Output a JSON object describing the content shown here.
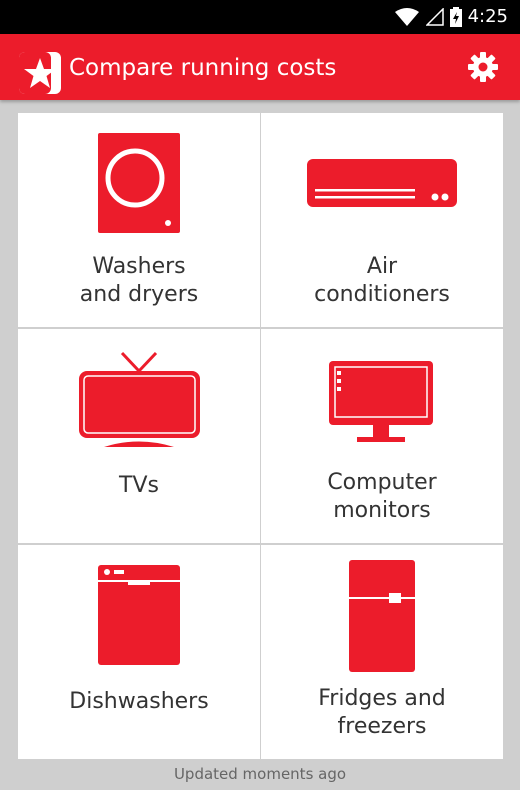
{
  "status_bar": {
    "time": "4:25"
  },
  "app_bar": {
    "title": "Compare running costs"
  },
  "tiles": [
    {
      "line1": "Washers",
      "line2": "and dryers",
      "icon": "washing-machine-icon"
    },
    {
      "line1": "Air",
      "line2": "conditioners",
      "icon": "air-conditioner-icon"
    },
    {
      "line1": "TVs",
      "line2": "",
      "icon": "tv-icon"
    },
    {
      "line1": "Computer",
      "line2": "monitors",
      "icon": "computer-monitor-icon"
    },
    {
      "line1": "Dishwashers",
      "line2": "",
      "icon": "dishwasher-icon"
    },
    {
      "line1": "Fridges and",
      "line2": "freezers",
      "icon": "fridge-icon"
    }
  ],
  "footer": {
    "text": "Updated moments ago"
  },
  "colors": {
    "accent": "#ec1c2b",
    "status_bar": "#000000",
    "background": "#cfcfcf",
    "tile": "#ffffff"
  }
}
